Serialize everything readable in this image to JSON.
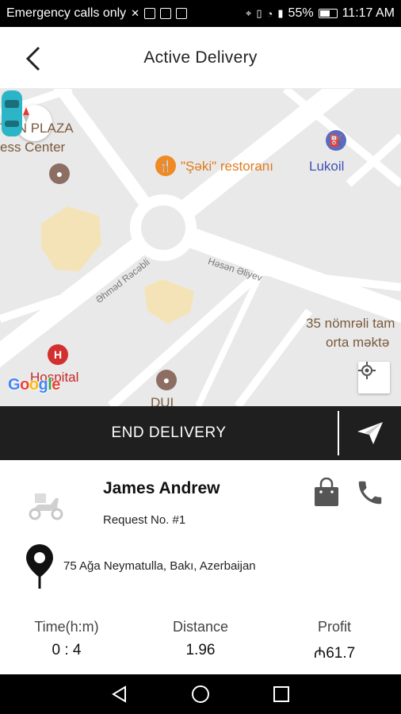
{
  "status_bar": {
    "carrier": "Emergency calls only",
    "battery": "55%",
    "time": "11:17 AM"
  },
  "header": {
    "title": "Active Delivery",
    "back_icon": "chevron-left-icon"
  },
  "map": {
    "labels": {
      "plaza_1": "TEN PLAZA",
      "plaza_2": "ess Center",
      "restaurant": "\"Şəki\" restoranı",
      "lukoil": "Lukoil",
      "street_1": "Əhməd Rəcəbli",
      "street_2": "Həsən Əliyev",
      "school_1": "35 nömrəli tam",
      "school_2": "orta məktə",
      "hospital": "Hospital",
      "dui": "DUI"
    },
    "colors": {
      "background": "#e9e9e9",
      "road": "#ffffff",
      "block": "#f5e3b8",
      "poi_brown": "#8d6e63",
      "poi_orange": "#f08a24",
      "poi_blue": "#5c6bc0",
      "poi_red": "#d32f2f",
      "car": "#2bb5c7"
    }
  },
  "actions": {
    "end_delivery": "END DELIVERY",
    "navigate_icon": "send-icon"
  },
  "customer": {
    "name": "James Andrew",
    "request": "Request No. #1",
    "address": "75 Ağa Neymatulla, Bakı, Azerbaijan"
  },
  "stats": {
    "time_label": "Time(h:m)",
    "time_value": "0 : 4",
    "distance_label": "Distance",
    "distance_value": "1.96",
    "profit_label": "Profit",
    "profit_value": "₼61.7"
  }
}
